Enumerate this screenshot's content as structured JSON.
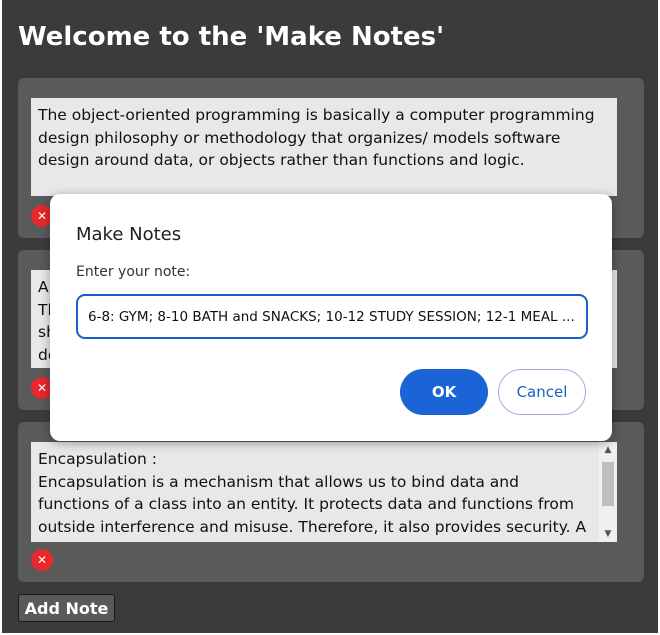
{
  "header": {
    "title": "Welcome to the 'Make Notes'"
  },
  "notes": [
    {
      "text": "The object-oriented programming is basically a computer programming design philosophy or methodology that organizes/ models software design around data, or objects rather than functions and logic.",
      "delete_icon": "✕"
    },
    {
      "text": "A\nTl\nsh\ndo",
      "delete_icon": "✕"
    },
    {
      "text": "Encapsulation :\nEncapsulation is a mechanism that allows us to bind data and functions of a class into an entity. It protects data and functions from outside interference and misuse. Therefore, it also provides security. A",
      "delete_icon": "✕"
    }
  ],
  "scroll": {
    "up_arrow": "▲",
    "down_arrow": "▼"
  },
  "footer": {
    "add_note_label": "Add Note"
  },
  "dialog": {
    "title": "Make Notes",
    "prompt": "Enter your note:",
    "input_value": "6-8: GYM; 8-10 BATH and SNACKS; 10-12 STUDY SESSION; 12-1 MEAL .....",
    "ok_label": "OK",
    "cancel_label": "Cancel"
  },
  "colors": {
    "app_background": "#3b3b3b",
    "card_background": "#5a5a5a",
    "note_background": "#e8e8e6",
    "delete_red": "#e8282b",
    "primary_blue": "#1b64d6"
  }
}
